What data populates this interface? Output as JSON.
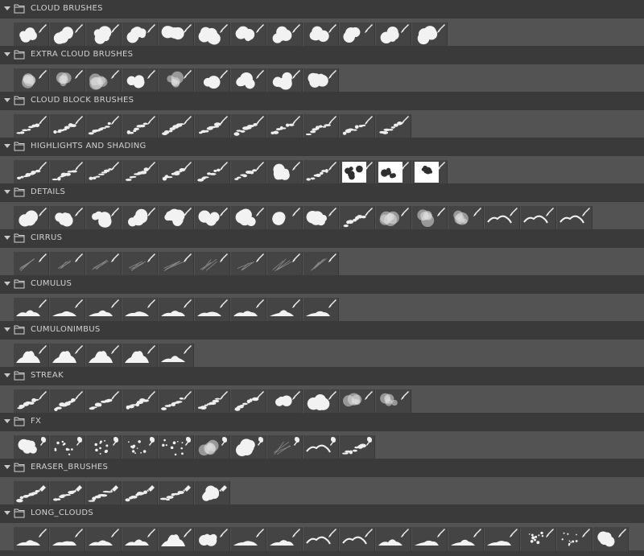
{
  "panel": {
    "groups": [
      {
        "title": "CLOUD BRUSHES",
        "count": 12,
        "styles": [
          "cloud",
          "cloud",
          "cloud",
          "cloud",
          "cloud",
          "cloud",
          "cloud",
          "cloud",
          "cloud",
          "cloud",
          "cloud",
          "cloud"
        ],
        "tool": "brush-icon"
      },
      {
        "title": "EXTRA CLOUD BRUSHES",
        "count": 9,
        "styles": [
          "soft",
          "soft",
          "soft",
          "cloud",
          "soft",
          "cloud",
          "cloud",
          "cloud",
          "cloud"
        ],
        "tool": "brush-icon"
      },
      {
        "title": "CLOUD BLOCK BRUSHES",
        "count": 11,
        "styles": [
          "streak",
          "streak",
          "streak",
          "streak",
          "streak",
          "streak",
          "streak",
          "streak",
          "streak",
          "streak",
          "streak"
        ],
        "tool": "brush-icon"
      },
      {
        "title": "HIGHLIGHTS AND SHADING",
        "count": 12,
        "styles": [
          "streak",
          "streak",
          "streak",
          "streak",
          "streak",
          "streak",
          "streak",
          "cloud",
          "streak",
          "inverse",
          "inverse",
          "inverse"
        ],
        "tool": "brush-icon"
      },
      {
        "title": "DETAILS",
        "count": 16,
        "styles": [
          "cloud",
          "cloud",
          "cloud",
          "cloud",
          "cloud",
          "cloud",
          "cloud",
          "cloud",
          "cloud",
          "streak",
          "soft",
          "soft",
          "soft",
          "ridge",
          "ridge",
          "ridge"
        ],
        "tool": "brush-icon"
      },
      {
        "title": "CIRRUS",
        "count": 9,
        "styles": [
          "wisp",
          "wisp",
          "wisp",
          "wisp",
          "wisp",
          "wisp",
          "wisp",
          "wisp",
          "wisp"
        ],
        "tool": "brush-icon"
      },
      {
        "title": "CUMULUS",
        "count": 9,
        "styles": [
          "flat",
          "flat",
          "flat",
          "flat",
          "flat",
          "flat",
          "flat",
          "flat",
          "flat"
        ],
        "tool": "brush-icon"
      },
      {
        "title": "CUMULONIMBUS",
        "count": 5,
        "styles": [
          "mound",
          "mound",
          "mound",
          "mound",
          "flat"
        ],
        "tool": "brush-icon"
      },
      {
        "title": "STREAK",
        "count": 11,
        "styles": [
          "streak",
          "streak",
          "streak",
          "streak",
          "streak",
          "streak",
          "streak",
          "cloud",
          "cloud",
          "soft",
          "soft"
        ],
        "tool": "brush-icon"
      },
      {
        "title": "FX",
        "count": 10,
        "styles": [
          "cloud",
          "dots",
          "dots",
          "dots",
          "dots",
          "soft",
          "cloud",
          "wisp",
          "ridge",
          "streak"
        ],
        "tool": "smudge-icon"
      },
      {
        "title": "ERASER_BRUSHES",
        "count": 6,
        "styles": [
          "streak",
          "streak",
          "streak",
          "streak",
          "streak",
          "cloud"
        ],
        "tool": "eraser-icon"
      },
      {
        "title": "LONG_CLOUDS",
        "count": 17,
        "styles": [
          "flat",
          "flat",
          "flat",
          "flat",
          "mound",
          "cloud",
          "flat",
          "flat",
          "ridge",
          "ridge",
          "flat",
          "flat",
          "flat",
          "flat",
          "dots",
          "dots",
          "cloud"
        ],
        "tool": "brush-icon"
      }
    ]
  },
  "colors": {
    "background": "#3c3c3c",
    "header": "#3a3a3a",
    "row": "#535353",
    "thumb": "#444444",
    "text": "#d2d2d2"
  }
}
